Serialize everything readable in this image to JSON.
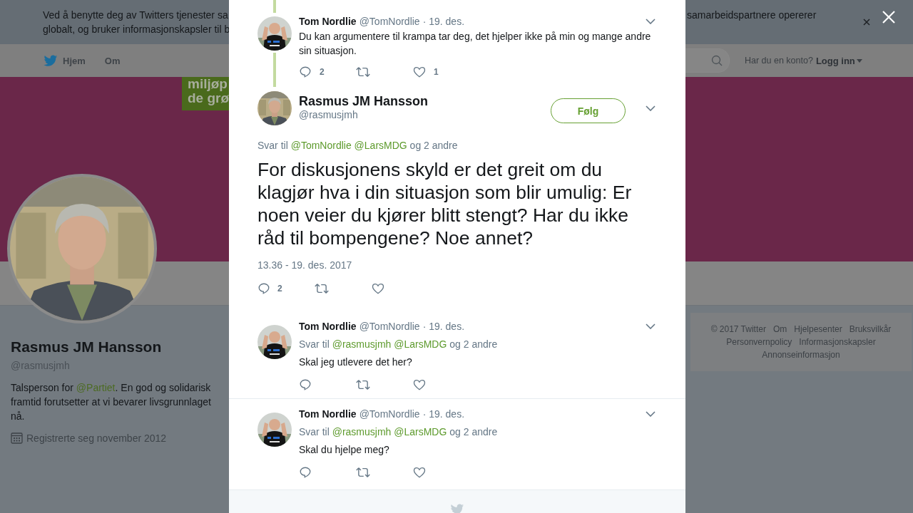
{
  "cookie_banner": {
    "left_lines": [
      "Ved å benytte deg av Twitters tjenester sa",
      "globalt, og bruker informasjonskapsler til b"
    ],
    "right_lines": [
      "samarbeidspartnere opererer"
    ]
  },
  "nav": {
    "items": [
      "Hjem",
      "Om"
    ],
    "account_prompt": "Har du en konto?",
    "login": "Logg inn"
  },
  "profile": {
    "cover_logo_lines": [
      "miljøp",
      "de grø"
    ],
    "name": "Rasmus JM Hansson",
    "handle": "@rasmusjmh",
    "bio": {
      "before": "Talsperson for",
      "link": "@Partiet",
      "after": ". En god og solidarisk framtid forutsetter at vi bevarer livsgrunnlaget nå."
    },
    "joined": "Registrerte seg november 2012"
  },
  "footer_links": [
    "© 2017 Twitter",
    "Om",
    "Hjelpesenter",
    "Bruksvilkår",
    "Personvernpolicy",
    "Informasjonskapsler",
    "Annonseinformasjon"
  ],
  "modal": {
    "parent_tweet": {
      "name": "Tom Nordlie",
      "handle": "@TomNordlie",
      "date": "· 19. des.",
      "text": "Du kan argumentere til krampa tar deg, det hjelper ikke på min og mange andre sin situasjon.",
      "replies": "2",
      "likes": "1"
    },
    "main_tweet": {
      "name": "Rasmus JM Hansson",
      "handle": "@rasmusjmh",
      "follow": "Følg",
      "reply_to": {
        "prefix": "Svar til",
        "mentions": [
          "@TomNordlie",
          "@LarsMDG"
        ],
        "suffix": "og 2 andre"
      },
      "text": "For diskusjonens skyld er det greit om du klagjør hva i din situasjon som blir umulig: Er noen veier du kjører blitt stengt? Har du ikke råd til bompengene? Noe annet?",
      "timestamp": "13.36 - 19. des. 2017",
      "replies": "2"
    },
    "replies": [
      {
        "name": "Tom Nordlie",
        "handle": "@TomNordlie",
        "date": "· 19. des.",
        "reply_to": {
          "prefix": "Svar til",
          "mentions": [
            "@rasmusjmh",
            "@LarsMDG"
          ],
          "suffix": "og 2 andre"
        },
        "text": "Skal jeg utlevere det her?"
      },
      {
        "name": "Tom Nordlie",
        "handle": "@TomNordlie",
        "date": "· 19. des.",
        "reply_to": {
          "prefix": "Svar til",
          "mentions": [
            "@rasmusjmh",
            "@LarsMDG"
          ],
          "suffix": "og 2 andre"
        },
        "text": "Skal du hjelpe meg?"
      }
    ]
  }
}
